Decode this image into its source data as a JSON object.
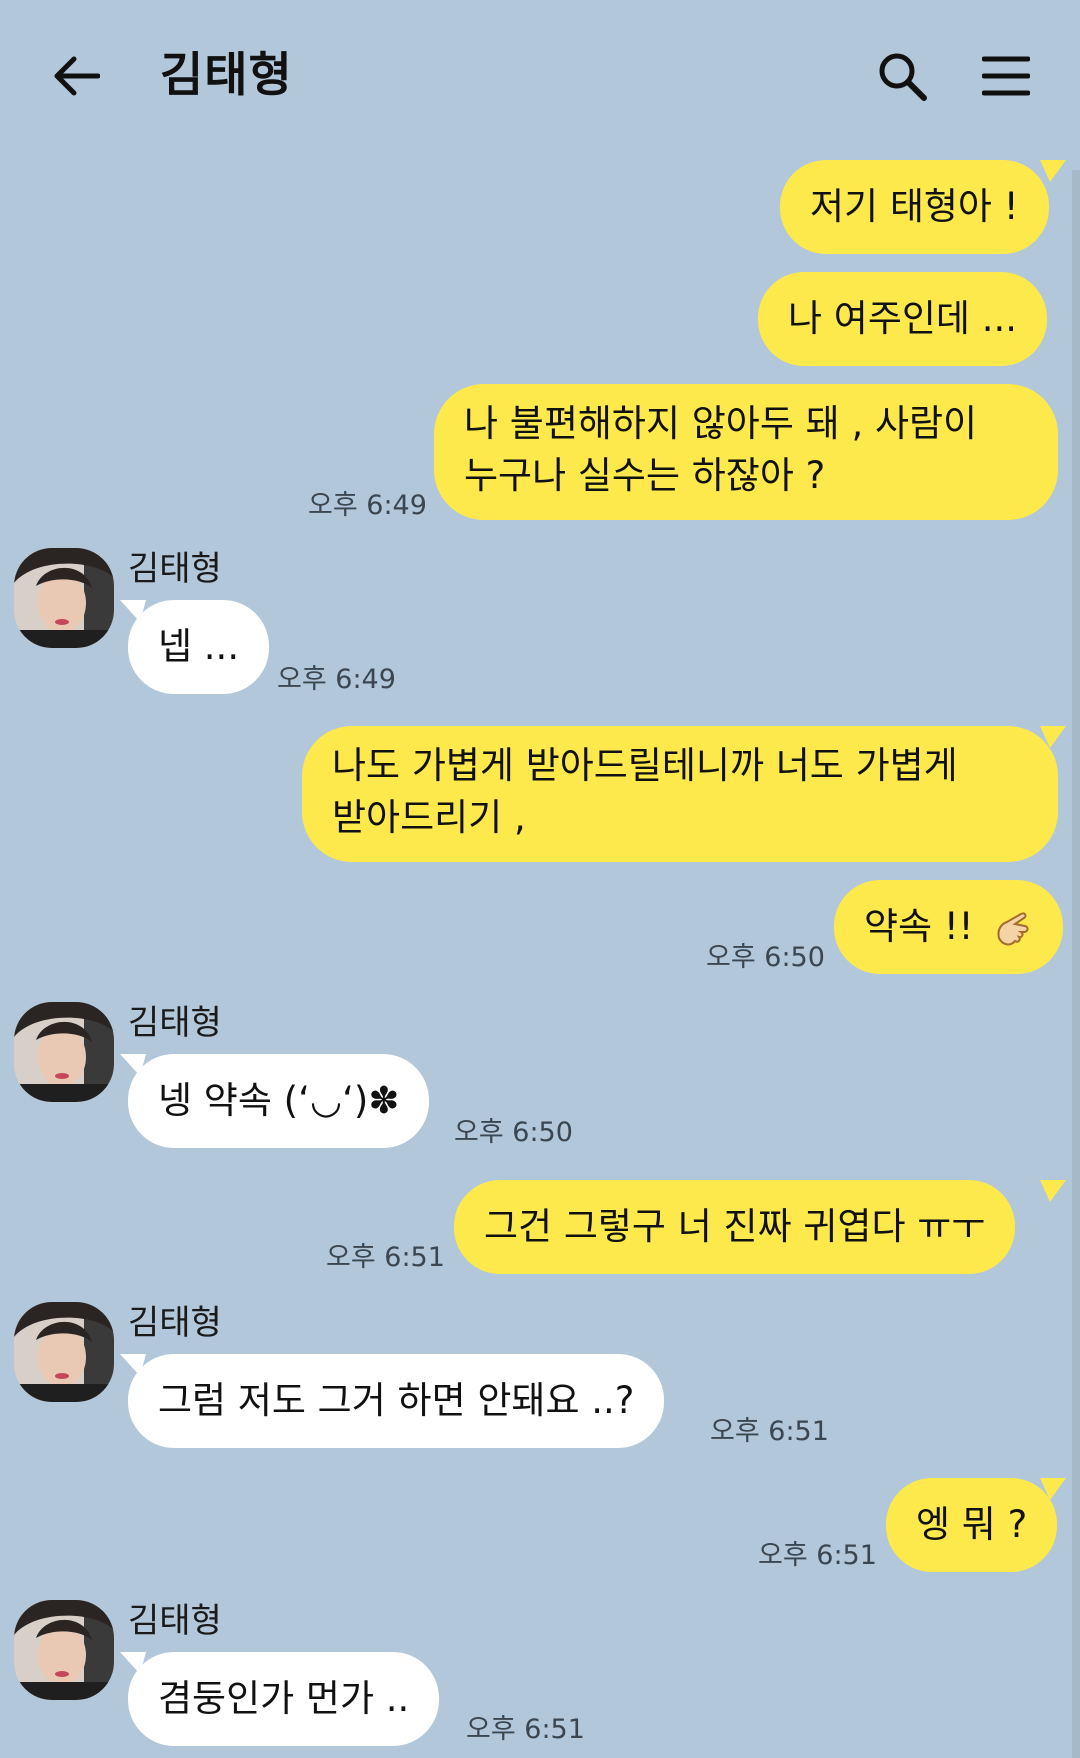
{
  "header": {
    "title": "김태형"
  },
  "contact": {
    "name": "김태형"
  },
  "messages": {
    "m1": {
      "text": "저기 태형아 !"
    },
    "m2": {
      "text": "나 여주인데 ..."
    },
    "m3": {
      "line1": "나 불편해하지 않아두 돼 , 사람이",
      "line2": "누구나 실수는 하잖아 ?",
      "time": "오후 6:49"
    },
    "m4": {
      "text": "넵 ...",
      "time": "오후 6:49"
    },
    "m5": {
      "line1": "나도 가볍게 받아드릴테니까 너도 가볍게",
      "line2": "받아드리기 ,"
    },
    "m6": {
      "text": "약속 !!",
      "time": "오후 6:50"
    },
    "m7": {
      "text": "넹 약속 (ʻ◡ʻ)✽",
      "time": "오후 6:50"
    },
    "m8": {
      "text": "그건 그렇구 너 진짜 귀엽다 ㅠㅜ",
      "time": "오후 6:51"
    },
    "m9": {
      "text": "그럼 저도 그거 하면 안돼요 ..?",
      "time": "오후 6:51"
    },
    "m10": {
      "text": "엥 뭐 ?",
      "time": "오후 6:51"
    },
    "m11": {
      "text": "겸둥인가 먼가 ..",
      "time": "오후 6:51"
    }
  },
  "icons": {
    "back": "back-arrow-icon",
    "search": "search-icon",
    "menu": "menu-icon",
    "hand": "pointing-hand-emoji"
  },
  "colors": {
    "background": "#b2c7d9",
    "mine_bubble": "#fee94c",
    "theirs_bubble": "#ffffff"
  }
}
